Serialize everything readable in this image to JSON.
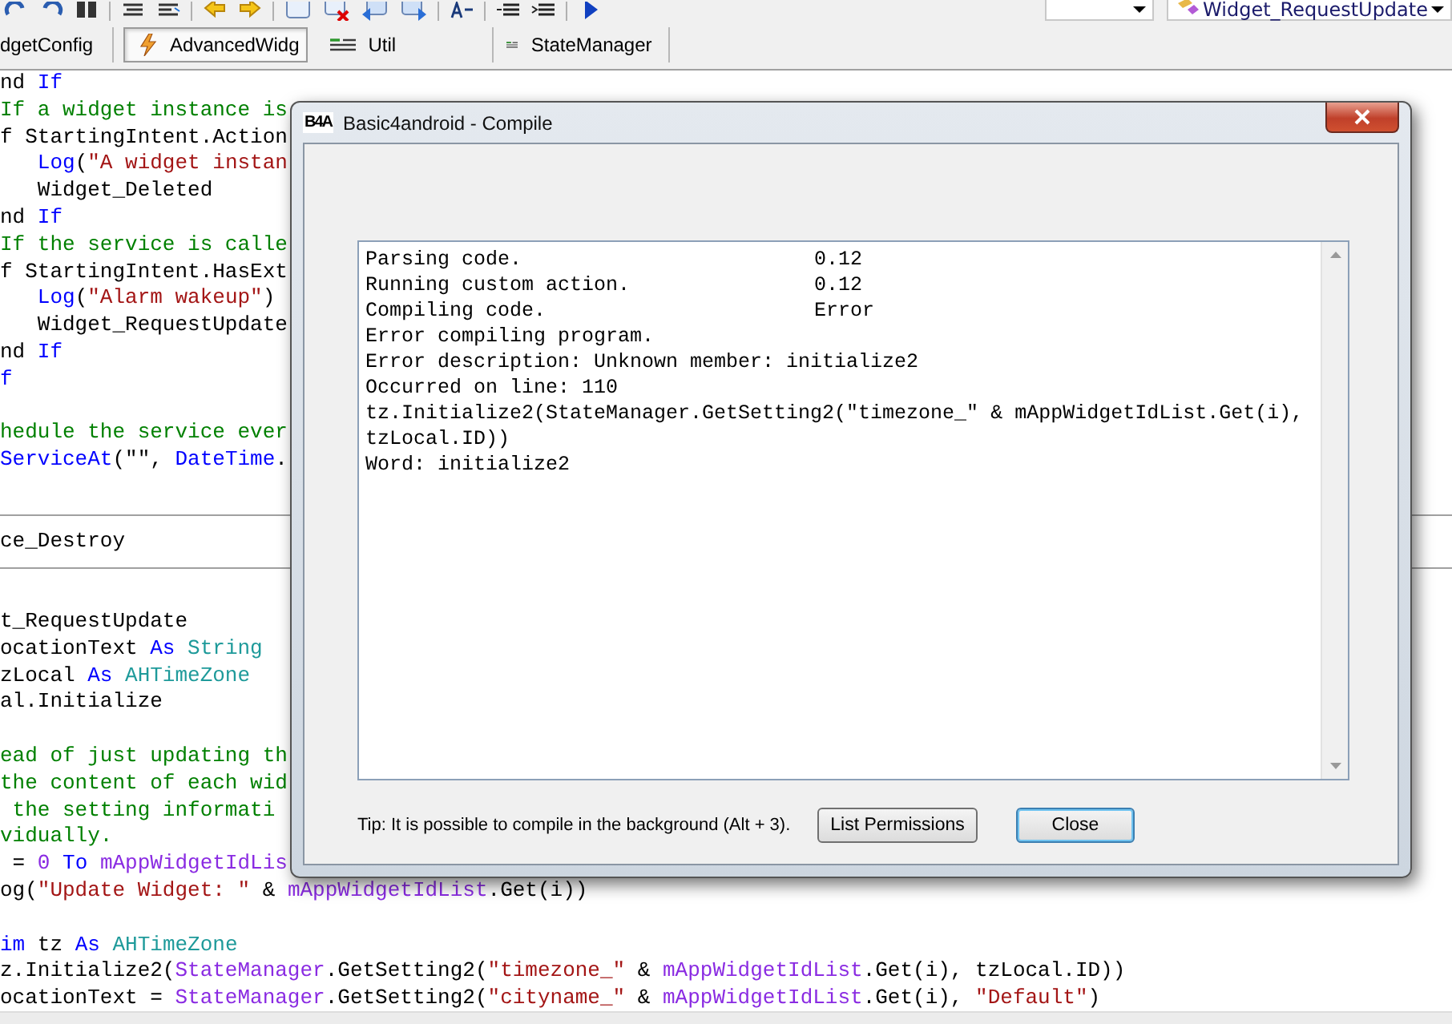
{
  "toolbar": {
    "combo_2": {
      "value": "Widget_RequestUpdate"
    }
  },
  "tabs": [
    {
      "label": "dgetConfig",
      "kind": "none",
      "selected": false
    },
    {
      "label": "AdvancedWidg",
      "kind": "service",
      "selected": true
    },
    {
      "label": "Util",
      "kind": "module",
      "selected": false
    },
    {
      "label": "StateManager",
      "kind": "module",
      "selected": false
    }
  ],
  "code_lines": [
    {
      "kind": "code",
      "tokens": [
        {
          "text": "nd ",
          "kind": "plain"
        },
        {
          "text": "If",
          "kind": "keyword"
        }
      ]
    },
    {
      "kind": "code",
      "tokens": [
        {
          "text": "If a widget instance is",
          "kind": "comment"
        }
      ]
    },
    {
      "kind": "code",
      "tokens": [
        {
          "text": "f StartingIntent.Action",
          "kind": "plain"
        }
      ]
    },
    {
      "kind": "code",
      "tokens": [
        {
          "text": "   Log",
          "kind": "keyword"
        },
        {
          "text": "(",
          "kind": "plain"
        },
        {
          "text": "\"A widget instan",
          "kind": "string"
        }
      ]
    },
    {
      "kind": "code",
      "tokens": [
        {
          "text": "   Widget_Deleted",
          "kind": "plain"
        }
      ]
    },
    {
      "kind": "code",
      "tokens": [
        {
          "text": "nd ",
          "kind": "plain"
        },
        {
          "text": "If",
          "kind": "keyword"
        }
      ]
    },
    {
      "kind": "code",
      "tokens": [
        {
          "text": "If the service is calle",
          "kind": "comment"
        }
      ]
    },
    {
      "kind": "code",
      "tokens": [
        {
          "text": "f StartingIntent.HasExt",
          "kind": "plain"
        }
      ]
    },
    {
      "kind": "code",
      "tokens": [
        {
          "text": "   Log",
          "kind": "keyword"
        },
        {
          "text": "(",
          "kind": "plain"
        },
        {
          "text": "\"Alarm wakeup\"",
          "kind": "string"
        },
        {
          "text": ")",
          "kind": "plain"
        }
      ]
    },
    {
      "kind": "code",
      "tokens": [
        {
          "text": "   Widget_RequestUpdate",
          "kind": "plain"
        }
      ]
    },
    {
      "kind": "code",
      "tokens": [
        {
          "text": "nd ",
          "kind": "plain"
        },
        {
          "text": "If",
          "kind": "keyword"
        }
      ]
    },
    {
      "kind": "code",
      "tokens": [
        {
          "text": "f",
          "kind": "keyword"
        }
      ]
    },
    {
      "kind": "blank"
    },
    {
      "kind": "code",
      "tokens": [
        {
          "text": "hedule the service ever",
          "kind": "comment"
        }
      ]
    },
    {
      "kind": "code",
      "tokens": [
        {
          "text": "ServiceAt",
          "kind": "keyword"
        },
        {
          "text": "(\"\", ",
          "kind": "plain"
        },
        {
          "text": "DateTime",
          "kind": "keyword"
        },
        {
          "text": ".",
          "kind": "plain"
        }
      ]
    },
    {
      "kind": "blank"
    },
    {
      "kind": "divider"
    },
    {
      "kind": "code",
      "tokens": [
        {
          "text": "ce_Destroy",
          "kind": "plain"
        }
      ]
    },
    {
      "kind": "divider"
    },
    {
      "kind": "blank"
    },
    {
      "kind": "code",
      "tokens": [
        {
          "text": "t_RequestUpdate",
          "kind": "plain"
        }
      ]
    },
    {
      "kind": "code",
      "tokens": [
        {
          "text": "ocationText ",
          "kind": "plain"
        },
        {
          "text": "As",
          "kind": "keyword"
        },
        {
          "text": " String",
          "kind": "type"
        }
      ]
    },
    {
      "kind": "code",
      "tokens": [
        {
          "text": "zLocal ",
          "kind": "plain"
        },
        {
          "text": "As",
          "kind": "keyword"
        },
        {
          "text": " AHTimeZone",
          "kind": "type"
        }
      ]
    },
    {
      "kind": "code",
      "tokens": [
        {
          "text": "al.Initialize",
          "kind": "plain"
        }
      ]
    },
    {
      "kind": "blank"
    },
    {
      "kind": "code",
      "tokens": [
        {
          "text": "ead of just updating th",
          "kind": "comment"
        }
      ]
    },
    {
      "kind": "code",
      "tokens": [
        {
          "text": "the content of each wid",
          "kind": "comment"
        }
      ]
    },
    {
      "kind": "code",
      "tokens": [
        {
          "text": " the setting informati",
          "kind": "comment"
        }
      ]
    },
    {
      "kind": "code",
      "tokens": [
        {
          "text": "vidually.",
          "kind": "comment"
        }
      ]
    },
    {
      "kind": "code",
      "tokens": [
        {
          "text": " = ",
          "kind": "plain"
        },
        {
          "text": "0",
          "kind": "number"
        },
        {
          "text": " To ",
          "kind": "keyword"
        },
        {
          "text": "mAppWidgetIdLis",
          "kind": "member"
        }
      ]
    },
    {
      "kind": "code",
      "tokens": [
        {
          "text": "og(",
          "kind": "plain"
        },
        {
          "text": "\"Update Widget: \"",
          "kind": "string"
        },
        {
          "text": " & ",
          "kind": "plain"
        },
        {
          "text": "mAppWidgetIdList",
          "kind": "member"
        },
        {
          "text": ".Get(i))",
          "kind": "plain"
        }
      ]
    },
    {
      "kind": "blank"
    },
    {
      "kind": "code",
      "tokens": [
        {
          "text": "im",
          "kind": "keyword"
        },
        {
          "text": " tz ",
          "kind": "plain"
        },
        {
          "text": "As",
          "kind": "keyword"
        },
        {
          "text": " AHTimeZone",
          "kind": "type"
        }
      ]
    },
    {
      "kind": "code",
      "tokens": [
        {
          "text": "z.Initialize2(",
          "kind": "plain"
        },
        {
          "text": "StateManager",
          "kind": "member"
        },
        {
          "text": ".GetSetting2(",
          "kind": "plain"
        },
        {
          "text": "\"timezone_\"",
          "kind": "string"
        },
        {
          "text": " & ",
          "kind": "plain"
        },
        {
          "text": "mAppWidgetIdList",
          "kind": "member"
        },
        {
          "text": ".Get(i), tzLocal.ID))",
          "kind": "plain"
        }
      ]
    },
    {
      "kind": "code",
      "tokens": [
        {
          "text": "ocationText = ",
          "kind": "plain"
        },
        {
          "text": "StateManager",
          "kind": "member"
        },
        {
          "text": ".GetSetting2(",
          "kind": "plain"
        },
        {
          "text": "\"cityname_\"",
          "kind": "string"
        },
        {
          "text": " & ",
          "kind": "plain"
        },
        {
          "text": "mAppWidgetIdList",
          "kind": "member"
        },
        {
          "text": ".Get(i), ",
          "kind": "plain"
        },
        {
          "text": "\"Default\"",
          "kind": "string"
        },
        {
          "text": ")",
          "kind": "plain"
        }
      ]
    }
  ],
  "dialog": {
    "icon_text": "B4A",
    "title": "Basic4android - Compile",
    "log": [
      {
        "text": "Parsing code.",
        "time": "0.12"
      },
      {
        "text": "Running custom action.",
        "time": "0.12"
      },
      {
        "text": "Compiling code.",
        "time": "Error"
      },
      {
        "text": "Error compiling program."
      },
      {
        "text": "Error description: Unknown member: initialize2"
      },
      {
        "text": "Occurred on line: 110"
      },
      {
        "text": "tz.Initialize2(StateManager.GetSetting2(\"timezone_\" & mAppWidgetIdList.Get(i),"
      },
      {
        "text": "tzLocal.ID))"
      },
      {
        "text": "Word: initialize2"
      }
    ],
    "tip": "Tip: It is possible to compile in the background (Alt + 3).",
    "buttons": [
      {
        "label": "List Permissions",
        "focused": false
      },
      {
        "label": "Close",
        "focused": true
      }
    ]
  }
}
